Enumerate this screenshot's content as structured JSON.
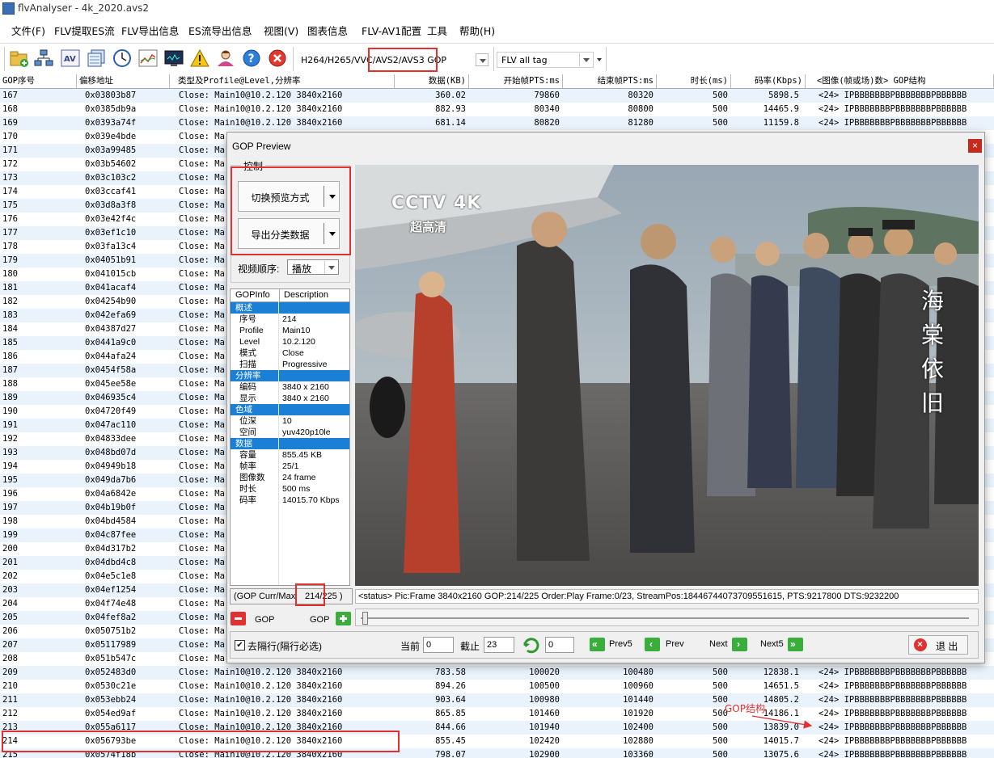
{
  "window": {
    "title": "flvAnalyser - 4k_2020.avs2"
  },
  "menu": [
    "文件(F)",
    "FLV提取ES流",
    "FLV导出信息",
    "ES流导出信息",
    "视图(V)",
    "图表信息",
    "FLV-AV1配置",
    "工具",
    "帮助(H)"
  ],
  "toolbar": {
    "icons": [
      "open-folder-icon",
      "network-icon",
      "av-icon",
      "frames-icon",
      "clock-icon",
      "chart-icon",
      "monitor-icon",
      "warning-icon",
      "user-icon",
      "help-icon",
      "stop-icon"
    ],
    "codec_combo": "H264/H265/VVC/AVS2/AVS3 GOP",
    "tag_combo": "FLV all tag"
  },
  "table": {
    "columns": [
      "GOP序号",
      "偏移地址",
      "类型及Profile@Level,分辨率",
      "数据(KB)",
      "开始帧PTS:ms",
      "结束帧PTS:ms",
      "时长(ms)",
      "码率(Kbps)",
      "<图像(帧或场)数> GOP结构"
    ],
    "visible_rows": [
      [
        "167",
        "0x03803b87",
        "Close: Main10@10.2.120  3840x2160",
        "360.02",
        "79860",
        "80320",
        "500",
        "5898.5",
        "<24> IPBBBBBBBPBBBBBBBPBBBBBB"
      ],
      [
        "168",
        "0x0385db9a",
        "Close: Main10@10.2.120  3840x2160",
        "882.93",
        "80340",
        "80800",
        "500",
        "14465.9",
        "<24> IPBBBBBBBPBBBBBBBPBBBBBB"
      ],
      [
        "169",
        "0x0393a74f",
        "Close: Main10@10.2.120  3840x2160",
        "681.14",
        "80820",
        "81280",
        "500",
        "11159.8",
        "<24> IPBBBBBBBPBBBBBBBPBBBBBB"
      ]
    ],
    "partial_rows": [
      [
        "170",
        "0x039e4bde"
      ],
      [
        "171",
        "0x03a99485"
      ],
      [
        "172",
        "0x03b54602"
      ],
      [
        "173",
        "0x03c103c2"
      ],
      [
        "174",
        "0x03ccaf41"
      ],
      [
        "175",
        "0x03d8a3f8"
      ],
      [
        "176",
        "0x03e42f4c"
      ],
      [
        "177",
        "0x03ef1c10"
      ],
      [
        "178",
        "0x03fa13c4"
      ],
      [
        "179",
        "0x04051b91"
      ],
      [
        "180",
        "0x041015cb"
      ],
      [
        "181",
        "0x041acaf4"
      ],
      [
        "182",
        "0x04254b90"
      ],
      [
        "183",
        "0x042efa69"
      ],
      [
        "184",
        "0x04387d27"
      ],
      [
        "185",
        "0x0441a9c0"
      ],
      [
        "186",
        "0x044afa24"
      ],
      [
        "187",
        "0x0454f58a"
      ],
      [
        "188",
        "0x045ee58e"
      ],
      [
        "189",
        "0x046935c4"
      ],
      [
        "190",
        "0x04720f49"
      ],
      [
        "191",
        "0x047ac110"
      ],
      [
        "192",
        "0x04833dee"
      ],
      [
        "193",
        "0x048bd07d"
      ],
      [
        "194",
        "0x04949b18"
      ],
      [
        "195",
        "0x049da7b6"
      ],
      [
        "196",
        "0x04a6842e"
      ],
      [
        "197",
        "0x04b19b0f"
      ],
      [
        "198",
        "0x04bd4584"
      ],
      [
        "199",
        "0x04c87fee"
      ],
      [
        "200",
        "0x04d317b2"
      ],
      [
        "201",
        "0x04dbd4c8"
      ],
      [
        "202",
        "0x04e5c1e8"
      ],
      [
        "203",
        "0x04ef1254"
      ],
      [
        "204",
        "0x04f74e48"
      ],
      [
        "205",
        "0x04fef8a2"
      ],
      [
        "206",
        "0x050751b2"
      ],
      [
        "207",
        "0x05117989"
      ],
      [
        "208",
        "0x051b547c"
      ]
    ],
    "partial_type": "Close: Ma",
    "bottom_rows": [
      [
        "209",
        "0x052483d0",
        "Close: Main10@10.2.120  3840x2160",
        "783.58",
        "100020",
        "100480",
        "500",
        "12838.1",
        "<24> IPBBBBBBBPBBBBBBBPBBBBBB"
      ],
      [
        "210",
        "0x0530c21e",
        "Close: Main10@10.2.120  3840x2160",
        "894.26",
        "100500",
        "100960",
        "500",
        "14651.5",
        "<24> IPBBBBBBBPBBBBBBBPBBBBBB"
      ],
      [
        "211",
        "0x053ebb24",
        "Close: Main10@10.2.120  3840x2160",
        "903.64",
        "100980",
        "101440",
        "500",
        "14805.2",
        "<24> IPBBBBBBBPBBBBBBBPBBBBBB"
      ],
      [
        "212",
        "0x054ed9af",
        "Close: Main10@10.2.120  3840x2160",
        "865.85",
        "101460",
        "101920",
        "500",
        "14186.1",
        "<24> IPBBBBBBBPBBBBBBBPBBBBBB"
      ],
      [
        "213",
        "0x055a6117",
        "Close: Main10@10.2.120  3840x2160",
        "844.66",
        "101940",
        "102400",
        "500",
        "13839.0",
        "<24> IPBBBBBBBPBBBBBBBPBBBBBB"
      ],
      [
        "214",
        "0x056793be",
        "Close: Main10@10.2.120  3840x2160",
        "855.45",
        "102420",
        "102880",
        "500",
        "14015.7",
        "<24> IPBBBBBBBPBBBBBBBPBBBBBB"
      ],
      [
        "215",
        "0x0574f18b",
        "Close: Main10@10.2.120  3840x2160",
        "798.07",
        "102900",
        "103360",
        "500",
        "13075.6",
        "<24> IPBBBBBBBPBBBBBBBPBBBBBB"
      ]
    ]
  },
  "annotation": {
    "gop_structure": "GOP结构"
  },
  "dialog": {
    "title": "GOP Preview",
    "close": "×",
    "control_group": "控制",
    "switch_preview": "切换预览方式",
    "export_class": "导出分类数据",
    "video_order_label": "视频顺序:",
    "video_order_value": "播放",
    "gopinfo_headers": [
      "GOPInfo",
      "Description"
    ],
    "gopinfo": [
      {
        "section": "概述"
      },
      {
        "k": "序号",
        "v": "214"
      },
      {
        "k": "Profile",
        "v": "Main10"
      },
      {
        "k": "Level",
        "v": "10.2.120"
      },
      {
        "k": "模式",
        "v": "Close"
      },
      {
        "k": "扫描",
        "v": "Progressive"
      },
      {
        "section": "分辨率"
      },
      {
        "k": "编码",
        "v": "3840 x 2160"
      },
      {
        "k": "显示",
        "v": "3840 x 2160"
      },
      {
        "section": "色域"
      },
      {
        "k": "位深",
        "v": "10"
      },
      {
        "k": "空间",
        "v": "yuv420p10le"
      },
      {
        "section": "数据"
      },
      {
        "k": "容量",
        "v": "855.45 KB"
      },
      {
        "k": "帧率",
        "v": "25/1"
      },
      {
        "k": "图像数",
        "v": "24 frame"
      },
      {
        "k": "时长",
        "v": "500 ms"
      },
      {
        "k": "码率",
        "v": "14015.70 Kbps"
      }
    ],
    "gop_curr_label": "(GOP Curr/Max",
    "gop_curr_value": "214/225 )",
    "status": "<status> Pic:Frame  3840x2160  GOP:214/225  Order:Play  Frame:0/23,  StreamPos:18446744073709551615,  PTS:9217800  DTS:9232200",
    "gop_minus": "GOP",
    "gop_plus": "GOP",
    "deinterlace": "去隔行(隔行必选)",
    "current_label": "当前",
    "current_value": "0",
    "end_label": "截止",
    "end_value": "23",
    "jump_value": "0",
    "prev5": "Prev5",
    "prev": "Prev",
    "next": "Next",
    "next5": "Next5",
    "exit": "退 出",
    "logo_text": "CCTV 4K",
    "logo_sub": "超高清",
    "caption": "海棠依旧",
    "colors": {
      "section": "#1a7fd5",
      "highlight": "#e03030",
      "green": "#3aae3a"
    }
  }
}
